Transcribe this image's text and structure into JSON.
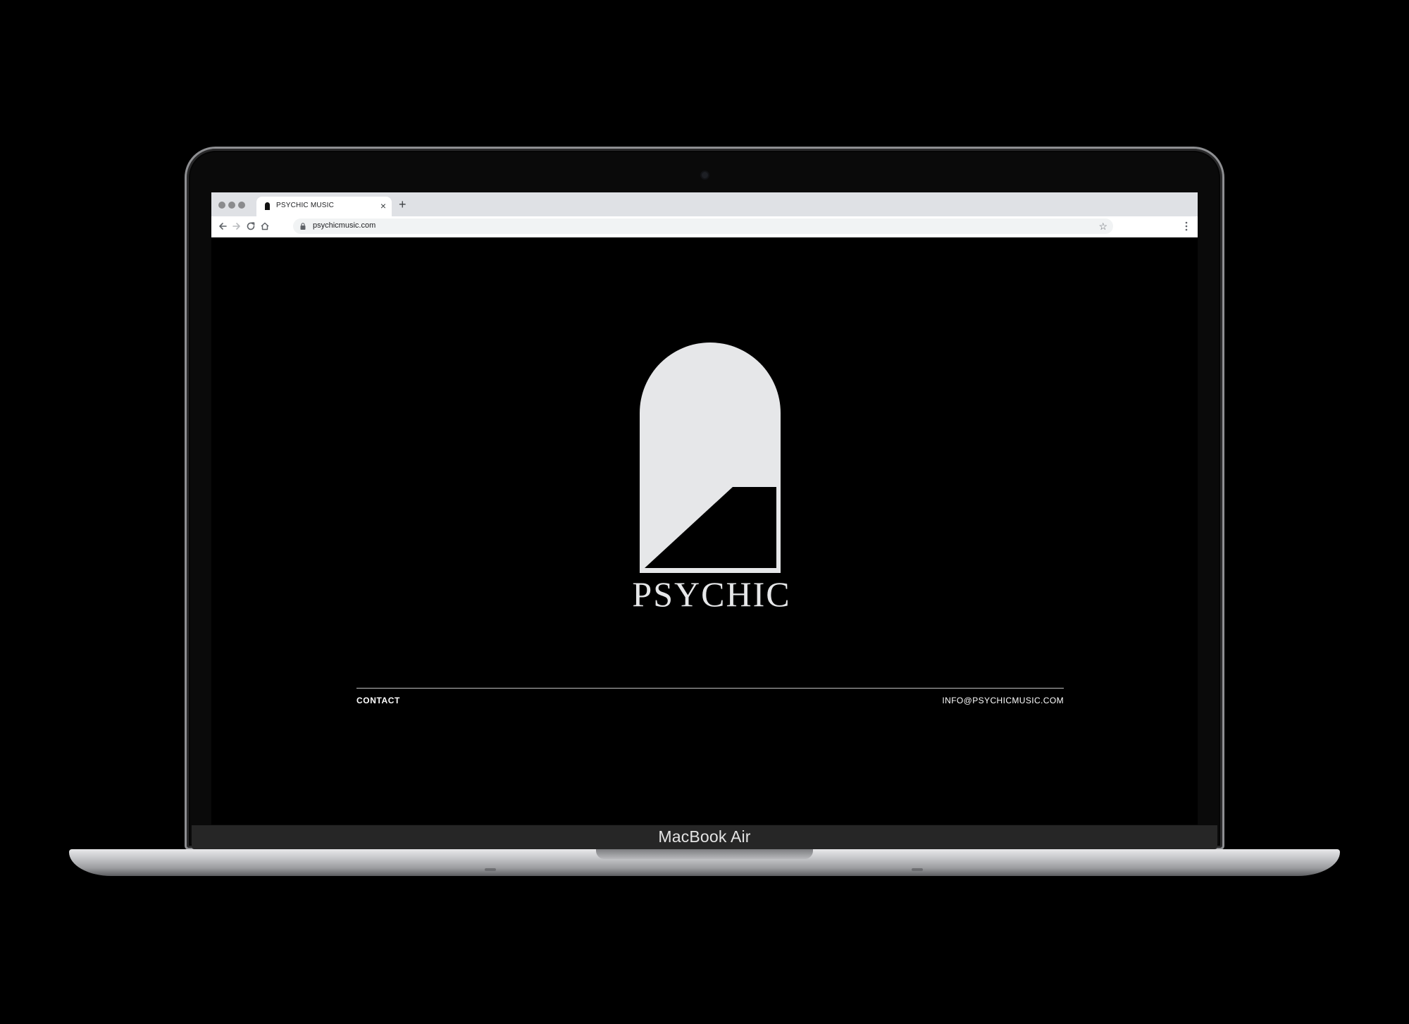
{
  "device": {
    "label": "MacBook Air"
  },
  "browser": {
    "tab_title": "PSYCHIC MUSIC",
    "tab_close": "×",
    "new_tab": "+",
    "url": "psychicmusic.com",
    "bookmark": "☆"
  },
  "page": {
    "brand": "PSYCHIC",
    "footer": {
      "contact_label": "CONTACT",
      "email": "INFO@PSYCHICMUSIC.COM"
    }
  },
  "colors": {
    "page_background": "#000000",
    "logo_fill": "#e6e7e9",
    "tabbar": "#dfe1e5"
  }
}
